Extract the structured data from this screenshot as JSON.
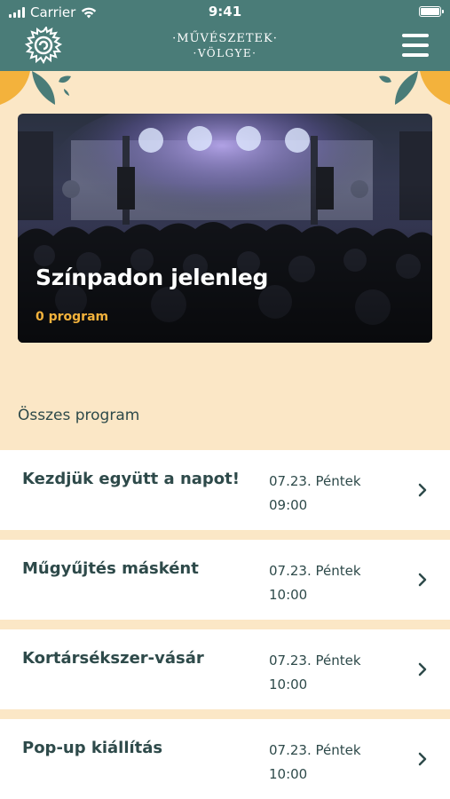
{
  "status_bar": {
    "carrier": "Carrier",
    "time": "9:41"
  },
  "header": {
    "brand_line1": "·MŰVÉSZETEK·",
    "brand_line2": "·VÖLGYE·"
  },
  "hero": {
    "title": "Színpadon jelenleg",
    "subtitle": "0 program"
  },
  "section": {
    "title": "Összes program"
  },
  "programs": [
    {
      "title": "Kezdjük együtt a napot!",
      "date": "07.23. Péntek",
      "time": "09:00"
    },
    {
      "title": "Műgyűjtés másként",
      "date": "07.23. Péntek",
      "time": "10:00"
    },
    {
      "title": "Kortársékszer-vásár",
      "date": "07.23. Péntek",
      "time": "10:00"
    },
    {
      "title": "Pop-up kiállítás",
      "date": "07.23. Péntek",
      "time": "10:00"
    }
  ],
  "colors": {
    "header_bg": "#4a7c78",
    "page_bg": "#fbe7c6",
    "accent": "#f3b23c",
    "text": "#2e4a4a"
  }
}
